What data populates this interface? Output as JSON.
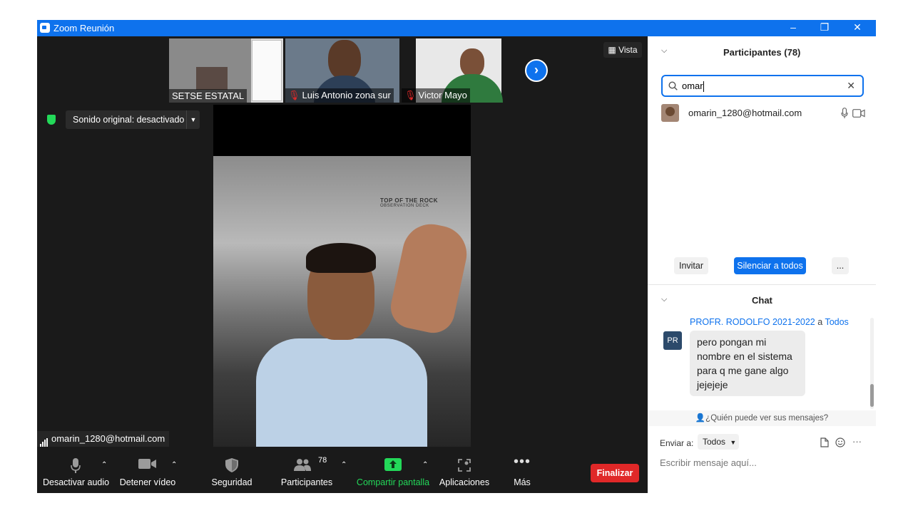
{
  "window": {
    "title": "Zoom Reunión",
    "controls": [
      "–",
      "❐",
      "✕"
    ]
  },
  "thumbnails": [
    {
      "name": "SETSE ESTATAL",
      "muted": false
    },
    {
      "name": "Luis Antonio zona sur",
      "muted": true
    },
    {
      "name": "Victor Mayo",
      "muted": true
    }
  ],
  "view_button": "Vista",
  "sound_dropdown": "Sonido original: desactivado",
  "main_video": {
    "logo_text": "TOP OF THE ROCK",
    "logo_sub": "OBSERVATION DECK",
    "speaker_name": "omarin_1280@hotmail.com"
  },
  "toolbar": {
    "audio": "Desactivar audio",
    "video": "Detener vídeo",
    "security": "Seguridad",
    "participants": "Participantes",
    "participants_count": "78",
    "share": "Compartir pantalla",
    "apps": "Aplicaciones",
    "more": "Más",
    "end": "Finalizar"
  },
  "participants_panel": {
    "title": "Participantes (78)",
    "search_value": "omar",
    "results": [
      {
        "name": "omarin_1280@hotmail.com"
      }
    ],
    "invite": "Invitar",
    "mute_all": "Silenciar a todos",
    "more": "..."
  },
  "chat": {
    "title": "Chat",
    "sender": "PROFR. RODOLFO 2021-2022",
    "to_word": "a",
    "recipient": "Todos",
    "avatar_initials": "PR",
    "message": "pero pongan mi nombre en el sistema para q me gane algo jejejeje",
    "who_can_see": "¿Quién puede ver sus mensajes?",
    "send_to_label": "Enviar a:",
    "send_to_value": "Todos",
    "input_placeholder": "Escribir mensaje aquí..."
  },
  "colors": {
    "zoom_blue": "#0e72ed",
    "end_red": "#e02828",
    "share_green": "#23d959",
    "dark_bg": "#1a1a1a"
  }
}
